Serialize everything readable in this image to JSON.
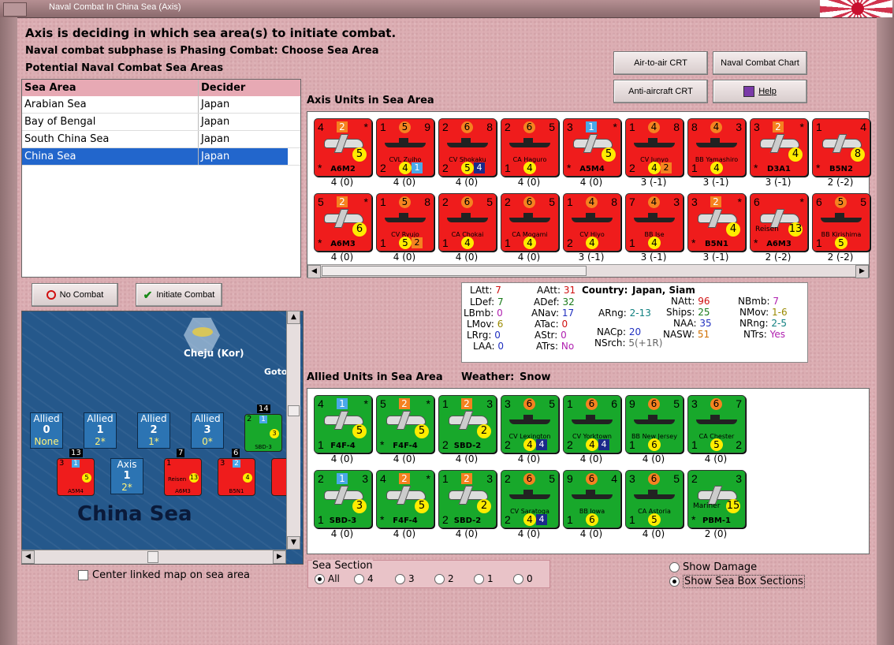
{
  "window": {
    "title": "Naval Combat In China Sea (Axis)"
  },
  "header": {
    "line1": "Axis is deciding in which sea area(s) to initiate combat.",
    "line2": "Naval combat subphase is Phasing Combat: Choose Sea Area",
    "line3": "Potential Naval Combat Sea Areas"
  },
  "buttons": {
    "air_to_air": "Air-to-air CRT",
    "naval_chart": "Naval Combat Chart",
    "anti_aircraft": "Anti-aircraft CRT",
    "help": "Help",
    "no_combat": "No Combat",
    "initiate_combat": "Initiate Combat"
  },
  "sea_table": {
    "headers": [
      "Sea Area",
      "Decider"
    ],
    "rows": [
      {
        "area": "Arabian Sea",
        "decider": "Japan"
      },
      {
        "area": "Bay of Bengal",
        "decider": "Japan"
      },
      {
        "area": "South China Sea",
        "decider": "Japan"
      },
      {
        "area": "China Sea",
        "decider": "Japan",
        "selected": true
      }
    ]
  },
  "axis_section": {
    "label": "Axis Units in Sea Area",
    "units": [
      {
        "kind": "plane",
        "tl": "4",
        "tc": "2",
        "tcs": "sq-or",
        "tr": "*",
        "bl": "*",
        "name": "A6M2",
        "y": "5",
        "str": "4 (0)"
      },
      {
        "kind": "ship",
        "tl": "1",
        "tc": "5",
        "tcs": "ci-or",
        "tr": "9",
        "bl": "2",
        "name": "CVL Zuiho",
        "ym": "4",
        "lb": "1",
        "str": "4 (0)"
      },
      {
        "kind": "ship",
        "tl": "2",
        "tc": "6",
        "tcs": "ci-or",
        "tr": "8",
        "bl": "2",
        "name": "CV Shokaku",
        "ym": "5",
        "nb": "4",
        "str": "4 (0)"
      },
      {
        "kind": "ship",
        "tl": "2",
        "tc": "6",
        "tcs": "ci-or",
        "tr": "5",
        "bl": "1",
        "name": "CA Haguro",
        "ym": "4",
        "str": "4 (0)"
      },
      {
        "kind": "plane",
        "tl": "3",
        "tc": "1",
        "tcs": "sq-bl",
        "tr": "*",
        "bl": "*",
        "name": "A5M4",
        "y": "5",
        "str": "4 (0)"
      },
      {
        "kind": "ship",
        "tl": "1",
        "tc": "4",
        "tcs": "ci-or",
        "tr": "8",
        "bl": "2",
        "name": "CV Junyo",
        "ym": "4",
        "ob": "2",
        "str": "3 (-1)"
      },
      {
        "kind": "ship",
        "tl": "8",
        "tc": "4",
        "tcs": "ci-or",
        "tr": "3",
        "bl": "1",
        "name": "BB Yamashiro",
        "ym": "4",
        "str": "3 (-1)"
      },
      {
        "kind": "plane",
        "tl": "3",
        "tc": "2",
        "tcs": "sq-or",
        "tr": "*",
        "bl": "*",
        "name": "D3A1",
        "y": "4",
        "str": "3 (-1)"
      },
      {
        "kind": "plane",
        "tl": "1",
        "tc": "",
        "tcs": "",
        "tr": "4",
        "bl": "*",
        "name": "B5N2",
        "y": "8",
        "str": "2 (-2)"
      },
      {
        "kind": "plane",
        "tl": "5",
        "tc": "2",
        "tcs": "sq-or",
        "tr": "*",
        "bl": "*",
        "name": "A6M3",
        "y": "6",
        "str": "4 (0)"
      },
      {
        "kind": "ship",
        "tl": "1",
        "tc": "5",
        "tcs": "ci-or",
        "tr": "8",
        "bl": "1",
        "name": "CV Ryujo",
        "ym": "5",
        "ob": "2",
        "str": "4 (0)"
      },
      {
        "kind": "ship",
        "tl": "2",
        "tc": "6",
        "tcs": "ci-or",
        "tr": "5",
        "bl": "1",
        "name": "CA Chokai",
        "ym": "4",
        "str": "4 (0)"
      },
      {
        "kind": "ship",
        "tl": "2",
        "tc": "6",
        "tcs": "ci-or",
        "tr": "5",
        "bl": "1",
        "name": "CA Mogami",
        "ym": "4",
        "str": "4 (0)"
      },
      {
        "kind": "ship",
        "tl": "1",
        "tc": "4",
        "tcs": "ci-or",
        "tr": "8",
        "bl": "2",
        "name": "CV Hiyo",
        "ym": "4",
        "str": "3 (-1)"
      },
      {
        "kind": "ship",
        "tl": "7",
        "tc": "4",
        "tcs": "ci-or",
        "tr": "3",
        "bl": "1",
        "name": "BB Ise",
        "ym": "4",
        "str": "3 (-1)"
      },
      {
        "kind": "plane",
        "tl": "3",
        "tc": "2",
        "tcs": "sq-or",
        "tr": "*",
        "bl": "*",
        "name": "B5N1",
        "y": "4",
        "str": "3 (-1)"
      },
      {
        "kind": "plane",
        "tl": "6",
        "tc": "",
        "tcs": "",
        "tr": "*",
        "bl": "*",
        "name": "A6M3",
        "sub": "Reisen",
        "y": "13",
        "str": "2 (-2)"
      },
      {
        "kind": "ship",
        "tl": "6",
        "tc": "5",
        "tcs": "ci-or",
        "tr": "5",
        "bl": "1",
        "name": "BB Kirishima",
        "ym": "5",
        "str": "2 (-2)"
      }
    ]
  },
  "stats": {
    "LAtt": "7",
    "LDef": "7",
    "LBmb": "0",
    "LMov": "6",
    "LRrg": "0",
    "LAA": "0",
    "AAtt": "31",
    "ADef": "32",
    "ANav": "17",
    "ATac": "0",
    "AStr": "0",
    "ATrs": "No",
    "country_label": "Country:",
    "country": "Japan, Siam",
    "ARng": "2-13",
    "NACp": "20",
    "NSrch": "5(+1R)",
    "NAtt": "96",
    "Ships": "25",
    "NAA": "35",
    "NASW": "51",
    "NBmb": "7",
    "NMov": "1-6",
    "NRng": "2-5",
    "NTrs": "Yes",
    "colors": {
      "red": "#d01010",
      "green": "#1a7a1a",
      "purple": "#b020b0",
      "olive": "#9a8a00",
      "blue": "#2030c0",
      "teal": "#108080",
      "orange": "#d07000",
      "gray": "#666666"
    }
  },
  "allied_section": {
    "label": "Allied Units in Sea Area",
    "weather_label": "Weather:",
    "weather": "Snow",
    "units": [
      {
        "kind": "plane",
        "tl": "4",
        "tc": "1",
        "tcs": "sq-bl",
        "tr": "*",
        "bl": "1",
        "name": "F4F-4",
        "y": "5",
        "str": "4 (0)"
      },
      {
        "kind": "plane",
        "tl": "5",
        "tc": "2",
        "tcs": "sq-or",
        "tr": "*",
        "bl": "*",
        "name": "F4F-4",
        "y": "5",
        "str": "4 (0)"
      },
      {
        "kind": "plane",
        "tl": "1",
        "tc": "2",
        "tcs": "sq-or",
        "tr": "3",
        "bl": "2",
        "name": "SBD-2",
        "y": "2",
        "str": "4 (0)"
      },
      {
        "kind": "ship",
        "tl": "3",
        "tc": "6",
        "tcs": "ci-or",
        "tr": "5",
        "bl": "2",
        "name": "CV Lexington",
        "ym": "4",
        "nb": "4",
        "str": "4 (0)"
      },
      {
        "kind": "ship",
        "tl": "1",
        "tc": "6",
        "tcs": "ci-or",
        "tr": "6",
        "bl": "2",
        "name": "CV Yorktown",
        "ym": "4",
        "nb": "4",
        "str": "4 (0)"
      },
      {
        "kind": "ship",
        "tl": "9",
        "tc": "6",
        "tcs": "ci-or",
        "tr": "5",
        "bl": "1",
        "name": "BB New Jersey",
        "ym": "6",
        "str": "4 (0)"
      },
      {
        "kind": "ship",
        "tl": "3",
        "tc": "6",
        "tcs": "ci-or",
        "tr": "7",
        "bl": "1",
        "name": "CA Chester",
        "ym": "5",
        "br": "2",
        "str": "4 (0)"
      },
      {
        "kind": "plane",
        "tl": "2",
        "tc": "1",
        "tcs": "sq-bl",
        "tr": "3",
        "bl": "1",
        "name": "SBD-3",
        "y": "3",
        "str": "4 (0)"
      },
      {
        "kind": "plane",
        "tl": "4",
        "tc": "2",
        "tcs": "sq-or",
        "tr": "*",
        "bl": "*",
        "name": "F4F-4",
        "y": "5",
        "str": "4 (0)"
      },
      {
        "kind": "plane",
        "tl": "1",
        "tc": "2",
        "tcs": "sq-or",
        "tr": "3",
        "bl": "2",
        "name": "SBD-2",
        "y": "2",
        "str": "4 (0)"
      },
      {
        "kind": "ship",
        "tl": "2",
        "tc": "6",
        "tcs": "ci-or",
        "tr": "5",
        "bl": "2",
        "name": "CV Saratoga",
        "ym": "4",
        "nb": "4",
        "str": "4 (0)"
      },
      {
        "kind": "ship",
        "tl": "9",
        "tc": "6",
        "tcs": "ci-or",
        "tr": "4",
        "bl": "1",
        "name": "BB Iowa",
        "ym": "6",
        "str": "4 (0)"
      },
      {
        "kind": "ship",
        "tl": "3",
        "tc": "6",
        "tcs": "ci-or",
        "tr": "5",
        "bl": "1",
        "name": "CA Astoria",
        "ym": "5",
        "str": "4 (0)"
      },
      {
        "kind": "plane",
        "tl": "2",
        "tc": "",
        "tcs": "",
        "tr": "3",
        "bl": "*",
        "name": "PBM-1",
        "sub": "Mariner",
        "y": "15",
        "str": "2 (0)"
      }
    ]
  },
  "map": {
    "sea_name": "China Sea",
    "island_label": "Cheju (Kor)",
    "goto_label": "Goto",
    "boxes": [
      {
        "title": "Allied",
        "num": "0",
        "val": "None"
      },
      {
        "title": "Allied",
        "num": "1",
        "val": "2*"
      },
      {
        "title": "Allied",
        "num": "2",
        "val": "1*"
      },
      {
        "title": "Allied",
        "num": "3",
        "val": "0*"
      },
      {
        "title": "Axis",
        "num": "1",
        "val": "2*"
      }
    ],
    "stack_counts": [
      "13",
      "7",
      "6",
      "14"
    ],
    "counters": [
      {
        "tl": "3",
        "tc": "1",
        "name": "A5M4",
        "y": "5"
      },
      {
        "tl": "1",
        "tc": "",
        "name": "A6M3",
        "sub": "Reisen",
        "y": "13"
      },
      {
        "tl": "3",
        "tc": "2",
        "name": "B5N1",
        "y": "4"
      },
      {
        "tl": "2",
        "tc": "1",
        "name": "SBD-3",
        "y": "3"
      }
    ]
  },
  "options": {
    "center_linked": "Center linked map on sea area",
    "show_damage": "Show Damage",
    "show_sections": "Show Sea Box Sections"
  },
  "sea_section": {
    "label": "Sea Section",
    "options": [
      "All",
      "4",
      "3",
      "2",
      "1",
      "0"
    ]
  }
}
